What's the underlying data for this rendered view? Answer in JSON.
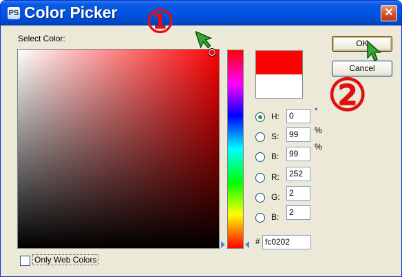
{
  "window": {
    "title": "Color Picker",
    "title_icon": "PS",
    "close_glyph": "✕"
  },
  "picker": {
    "select_label": "Select Color:",
    "selected_color": "#fc0202",
    "previous_color": "#ffffff"
  },
  "fields": {
    "h": {
      "label": "H:",
      "value": "0",
      "unit": "°",
      "checked": true
    },
    "s": {
      "label": "S:",
      "value": "99",
      "unit": "%",
      "checked": false
    },
    "b": {
      "label": "B:",
      "value": "99",
      "unit": "%",
      "checked": false
    },
    "r": {
      "label": "R:",
      "value": "252",
      "checked": false
    },
    "g": {
      "label": "G:",
      "value": "2",
      "checked": false
    },
    "bl": {
      "label": "B:",
      "value": "2",
      "checked": false
    }
  },
  "hex": {
    "prefix": "#",
    "value": "fc0202"
  },
  "buttons": {
    "ok": "OK",
    "cancel": "Cancel"
  },
  "web_colors": {
    "label": "Only Web Colors",
    "checked": false
  },
  "annotations": {
    "step1": "①",
    "step2": "②",
    "color": "#e01010"
  },
  "icons": {
    "cursor_1": "green-arrow-cursor-icon",
    "cursor_2": "green-arrow-cursor-icon"
  }
}
